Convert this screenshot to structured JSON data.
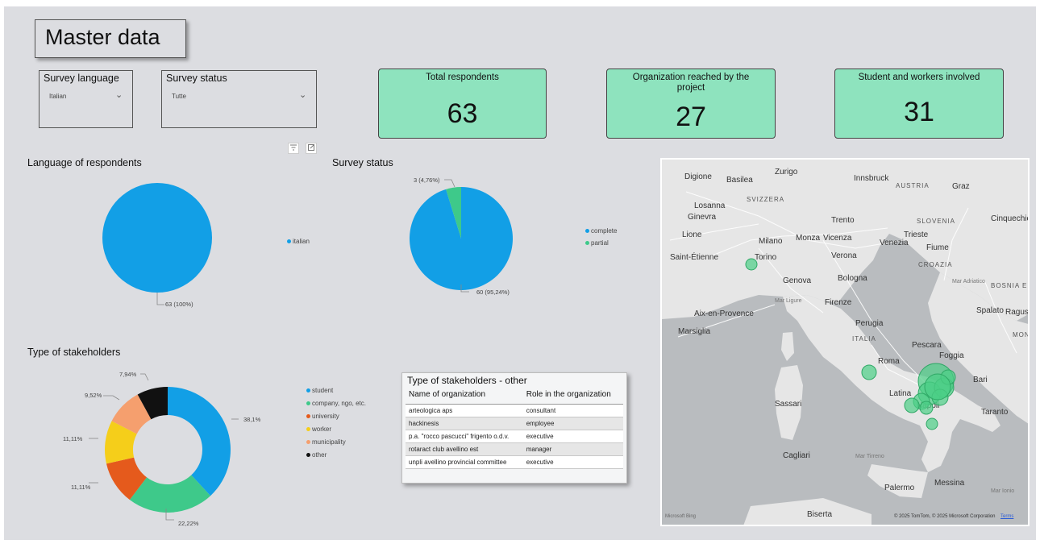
{
  "page_title": "Master data",
  "filters": {
    "survey_language": {
      "label": "Survey language",
      "value": "Italian"
    },
    "survey_status": {
      "label": "Survey status",
      "value": "Tutte"
    }
  },
  "cards": [
    {
      "title": "Total respondents",
      "value": "63"
    },
    {
      "title": "Organization reached by the project",
      "value": "27"
    },
    {
      "title": "Student and workers involved",
      "value": "31"
    }
  ],
  "visual_icons": [
    "filter-icon",
    "focus-mode-icon"
  ],
  "chart_data": [
    {
      "type": "pie",
      "title": "Language of respondents",
      "categories": [
        "italian"
      ],
      "values": [
        63
      ],
      "data_labels": [
        "63 (100%)"
      ],
      "colors": [
        "#129fe6"
      ],
      "legend_position": "right"
    },
    {
      "type": "pie",
      "title": "Survey status",
      "categories": [
        "complete",
        "partial"
      ],
      "values": [
        60,
        3
      ],
      "data_labels": [
        "60 (95,24%)",
        "3 (4,76%)"
      ],
      "colors": [
        "#129fe6",
        "#3ec98a"
      ],
      "legend_position": "right"
    },
    {
      "type": "pie",
      "donut": true,
      "title": "Type of stakeholders",
      "categories": [
        "student",
        "company, ngo, etc.",
        "university",
        "worker",
        "municipality",
        "other"
      ],
      "values": [
        38.1,
        22.22,
        11.11,
        11.11,
        9.52,
        7.94
      ],
      "data_labels": [
        "38,1%",
        "22,22%",
        "11,11%",
        "11,11%",
        "9,52%",
        "7,94%"
      ],
      "colors": [
        "#129fe6",
        "#3ec98a",
        "#e55a1c",
        "#f5ce1a",
        "#f59f6e",
        "#111111"
      ],
      "legend_position": "right"
    }
  ],
  "table": {
    "title": "Type of stakeholders - other",
    "columns": [
      "Name of organization",
      "Role in the organization"
    ],
    "rows": [
      [
        "arteologica aps",
        "consultant"
      ],
      [
        "hackinesis",
        "employee"
      ],
      [
        "p.a. \"rocco pascucci\" frigento o.d.v.",
        "executive"
      ],
      [
        "rotaract club avellino est",
        "manager"
      ],
      [
        "unpli avellino provincial committee",
        "executive"
      ]
    ]
  },
  "map": {
    "labels": {
      "countries": [
        "SVIZZERA",
        "AUSTRIA",
        "SLOVENIA",
        "CROAZIA",
        "BOSNIA ED ERZEGOVINA",
        "ITALIA",
        "MONT"
      ],
      "cities": [
        "Digione",
        "Basilea",
        "Zurigo",
        "Innsbruck",
        "Graz",
        "Losanna",
        "Ginevra",
        "Lione",
        "Saint-Étienne",
        "Milano",
        "Monza",
        "Vicenza",
        "Venezia",
        "Trento",
        "Trieste",
        "Fiume",
        "Cinquechie",
        "Torino",
        "Genova",
        "Bologna",
        "Verona",
        "Firenze",
        "Perugia",
        "Roma",
        "Pescara",
        "Foggia",
        "Latina",
        "Napoli",
        "Taranto",
        "Bari",
        "Spalato",
        "Ragusa",
        "Aix-en-Provence",
        "Marsiglia",
        "Sassari",
        "Cagliari",
        "Palermo",
        "Messina",
        "Biserta"
      ],
      "seas": [
        "Mar Tirreno",
        "Mar Ionio",
        "Mar Ligure",
        "Mar Adriatico"
      ],
      "attribution": "© 2025 TomTom, © 2025 Microsoft Corporation",
      "terms": "Terms",
      "brand": "Microsoft Bing"
    },
    "bubble_color": "#4ccf86"
  }
}
